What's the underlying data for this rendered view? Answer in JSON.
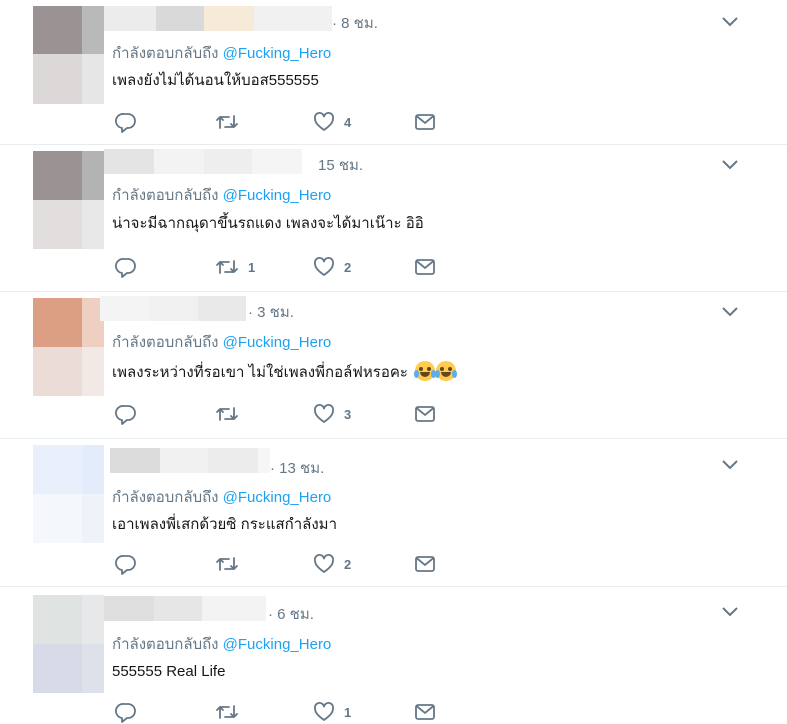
{
  "colors": {
    "accent": "#1da1f2",
    "secondary_text": "#657786",
    "primary_text": "#14171a",
    "divider": "#e6ecf0"
  },
  "icons": {
    "more": "chevron-down-icon",
    "reply": "reply-icon",
    "retweet": "retweet-icon",
    "like": "heart-icon",
    "dm": "envelope-icon"
  },
  "replies": [
    {
      "time": "· 8 ชม.",
      "replying_prefix": "กำลังตอบกลับถึง",
      "mention": "@Fucking_Hero",
      "text": "เพลงยังไม่ได้นอนให้บอส555555",
      "retweets": "",
      "likes": "4"
    },
    {
      "time": "15 ชม.",
      "replying_prefix": "กำลังตอบกลับถึง",
      "mention": "@Fucking_Hero",
      "text": "น่าจะมีฉากณุดาขึ้นรถแดง เพลงจะได้มาเน๊าะ อิอิ",
      "retweets": "1",
      "likes": "2"
    },
    {
      "time": "· 3 ชม.",
      "replying_prefix": "กำลังตอบกลับถึง",
      "mention": "@Fucking_Hero",
      "text": "เพลงระหว่างที่รอเขา ไม่ใช่เพลงพี่กอล์ฟหรอคะ",
      "retweets": "",
      "likes": "3"
    },
    {
      "time": "· 13 ชม.",
      "replying_prefix": "กำลังตอบกลับถึง",
      "mention": "@Fucking_Hero",
      "text": "เอาเพลงพี่เสกด้วยซิ กระแสกำลังมา",
      "retweets": "",
      "likes": "2"
    },
    {
      "time": "· 6 ชม.",
      "replying_prefix": "กำลังตอบกลับถึง",
      "mention": "@Fucking_Hero",
      "text": "555555 Real Life",
      "retweets": "",
      "likes": "1"
    }
  ]
}
